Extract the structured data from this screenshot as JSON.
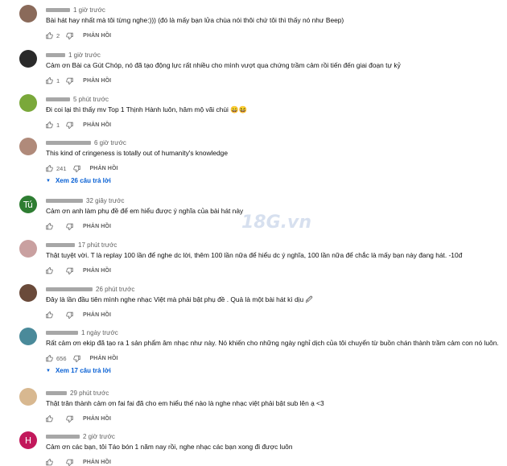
{
  "watermark": "18G.vn",
  "comments": [
    {
      "time": "1 giờ trước",
      "text": "Bài hát hay nhất mà tôi từng nghe:))) (đó là mấy bạn lửa chùa nói thôi chứ tôi thì thấy nó như Beep)",
      "likes": "2",
      "reply": "PHẢN HỒI",
      "avatar": {
        "letter": "",
        "color": "#8a6a5a"
      }
    },
    {
      "time": "1 giờ trước",
      "text": "Cảm ơn Bài ca Gút Chóp, nó đã tạo động lực rất nhiều cho mình vượt qua chứng trầm cảm rồi tiến đến giai đoạn tự kỷ",
      "likes": "1",
      "reply": "PHẢN HỒI",
      "avatar": {
        "letter": "",
        "color": "#2a2a2a"
      }
    },
    {
      "time": "5 phút trước",
      "text": "Đi coi lại thì thấy mv Top 1 Thịnh Hành luôn, hâm mộ vãi chùi 😄😆",
      "likes": "1",
      "reply": "PHẢN HỒI",
      "avatar": {
        "letter": "",
        "color": "#7aa83a"
      }
    },
    {
      "time": "6 giờ trước",
      "text": "This kind of cringeness is totally out of humanity's knowledge",
      "likes": "241",
      "reply": "PHẢN HỒI",
      "avatar": {
        "letter": "",
        "color": "#b08a7a"
      },
      "more": "Xem 26 câu trả lời"
    },
    {
      "time": "32 giây trước",
      "text": "Cảm ơn anh làm phụ đề để em hiểu được ý nghĩa của bài hát này",
      "likes": "",
      "reply": "PHẢN HỒI",
      "avatar": {
        "letter": "Tú",
        "color": "#2e7d32"
      }
    },
    {
      "time": "17 phút trước",
      "text": "Thật tuyệt vời. T là replay 100 lần để nghe dc lời, thêm 100 lần nữa để hiểu dc ý nghĩa, 100 lần nữa để chắc là mấy bạn này đang hát. -10đ",
      "likes": "",
      "reply": "PHẢN HỒI",
      "avatar": {
        "letter": "",
        "color": "#c9a0a0"
      }
    },
    {
      "time": "26 phút trước",
      "text": "Đây là lần đầu tiên mình nghe nhạc Việt mà phải bật phụ đề . Quả là một bài hát kì dịu 🖉",
      "likes": "",
      "reply": "PHẢN HỒI",
      "avatar": {
        "letter": "",
        "color": "#6a4a3a"
      }
    },
    {
      "time": "1 ngày trước",
      "text": "Rất cảm ơn ekip đã tạo ra 1 sản phẩm âm nhạc như này. Nó khiến cho những ngày nghỉ dịch của tôi chuyển từ buồn chán thành trầm cảm con      nó luôn.",
      "likes": "656",
      "reply": "PHẢN HỒI",
      "avatar": {
        "letter": "",
        "color": "#4a8a9a"
      },
      "more": "Xem 17 câu trả lời"
    },
    {
      "time": "29 phút trước",
      "text": "Thật trân thành cảm ơn fai fai đã cho em hiểu thế nào là nghe nhạc việt phải bật sub lên ạ <3",
      "likes": "",
      "reply": "PHẢN HỒI",
      "avatar": {
        "letter": "",
        "color": "#d8b890"
      }
    },
    {
      "time": "2 giờ trước",
      "text": "Cảm ơn các bạn, tôi Táo bón 1 năm nay rồi, nghe nhạc các bạn xong đi được luôn",
      "likes": "",
      "reply": "PHẢN HỒI",
      "avatar": {
        "letter": "H",
        "color": "#c2185b"
      }
    }
  ]
}
